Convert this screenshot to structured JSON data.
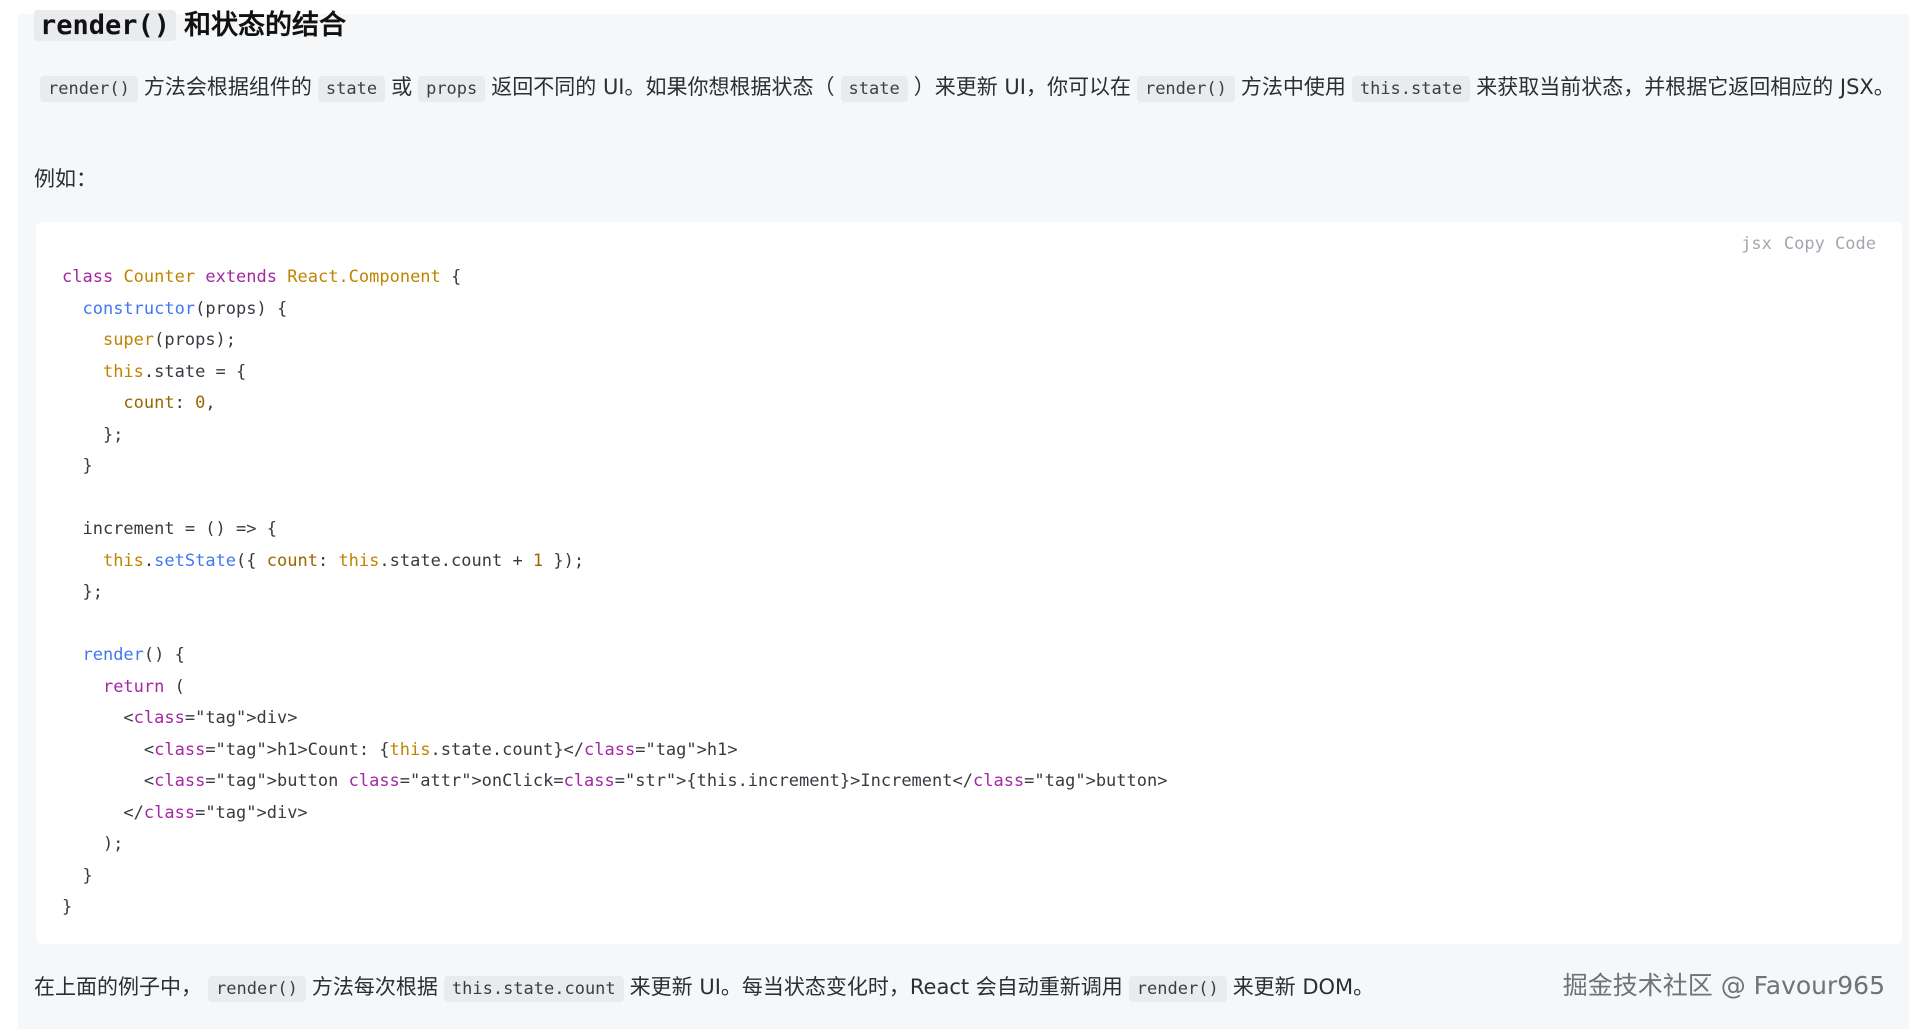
{
  "heading": {
    "code": "render()",
    "text": "和状态的结合"
  },
  "para1": {
    "t1": "render()",
    "s1": "方法会根据组件的",
    "t2": "state",
    "s2": "或",
    "t3": "props",
    "s3": "返回不同的 UI。如果你想根据状态（",
    "t4": "state",
    "s4": "）来更新 UI，你可以在",
    "t5": "render()",
    "s5": "方法中使用",
    "t6": "this.state",
    "s6": "来获取当前状态，并根据它返回相应的 JSX。"
  },
  "para2": "例如：",
  "code_toolbar": {
    "lang": "jsx",
    "copy": "Copy Code"
  },
  "code_lines": [
    "class Counter extends React.Component {",
    "  constructor(props) {",
    "    super(props);",
    "    this.state = {",
    "      count: 0,",
    "    };",
    "  }",
    "",
    "  increment = () => {",
    "    this.setState({ count: this.state.count + 1 });",
    "  };",
    "",
    "  render() {",
    "    return (",
    "      <div>",
    "        <h1>Count: {this.state.count}</h1>",
    "        <button onClick={this.increment}>Increment</button>",
    "      </div>",
    "    );",
    "  }",
    "}"
  ],
  "para3": {
    "s1": "在上面的例子中，",
    "t1": "render()",
    "s2": "方法每次根据",
    "t2": "this.state.count",
    "s3": "来更新 UI。每当状态变化时，React 会自动重新调用",
    "t3": "render()",
    "s4": "来更新 DOM。"
  },
  "watermark": "掘金技术社区 @ Favour965"
}
